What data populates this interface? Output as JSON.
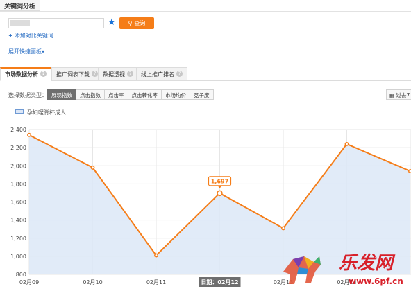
{
  "header": {
    "tab_label": "关键词分析"
  },
  "search": {
    "value": "",
    "button_label": "查询"
  },
  "add_compare_label": "添加对比关键词",
  "expand_panel_label": "展开快捷面板",
  "tabs": [
    {
      "label": "市场数据分析",
      "active": true
    },
    {
      "label": "推广词表下载",
      "active": false
    },
    {
      "label": "数据透视",
      "active": false
    },
    {
      "label": "线上推广排名",
      "active": false
    }
  ],
  "data_type": {
    "label": "选择数据类型：",
    "options": [
      {
        "label": "展现指数",
        "active": true
      },
      {
        "label": "点击指数",
        "active": false
      },
      {
        "label": "点击率",
        "active": false
      },
      {
        "label": "点击转化率",
        "active": false
      },
      {
        "label": "市场均价",
        "active": false
      },
      {
        "label": "竞争度",
        "active": false
      }
    ],
    "period_label": "过去7"
  },
  "colors": {
    "accent": "#f57d18",
    "line": "#f57d18",
    "area": "#dce7f7",
    "link": "#2b6fc4"
  },
  "chart_data": {
    "type": "area",
    "series": [
      {
        "name": "孕妇嗳脊杯成人",
        "values": [
          2340,
          1980,
          1010,
          1697,
          1310,
          2240,
          1940
        ]
      }
    ],
    "categories": [
      "02月09",
      "02月10",
      "02月11",
      "02月12",
      "02月13",
      "02月14",
      "02月15"
    ],
    "y_ticks": [
      "2,400",
      "2,200",
      "2,000",
      "1,800",
      "1,600",
      "1,400",
      "1,200",
      "1,000",
      "800"
    ],
    "ylim": [
      800,
      2400
    ],
    "highlight": {
      "value_label": "1,697",
      "date_label": "日期：02月12"
    },
    "grid": true,
    "legend_position": "top-left"
  }
}
